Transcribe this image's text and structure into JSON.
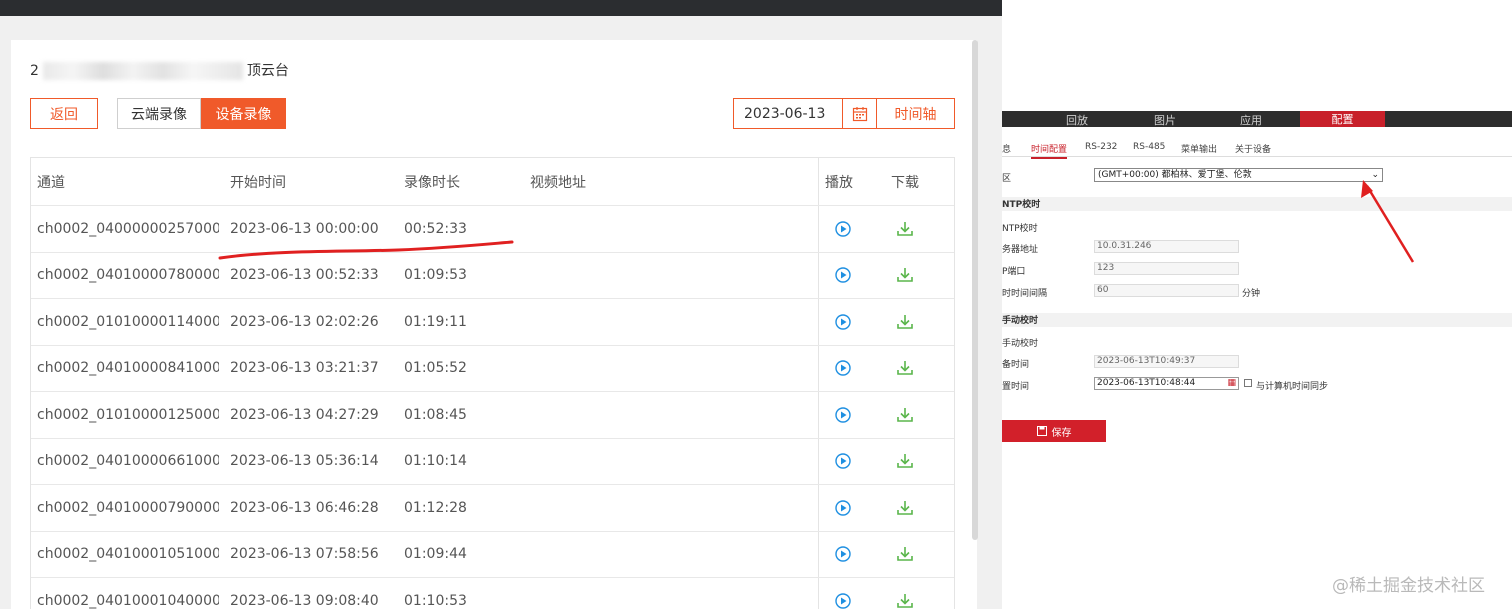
{
  "header": {
    "prefix": "2",
    "suffix": "顶云台"
  },
  "toolbar": {
    "back": "返回",
    "cloud": "云端录像",
    "device": "设备录像",
    "date": "2023-06-13",
    "timeline": "时间轴"
  },
  "table": {
    "columns": [
      "通道",
      "开始时间",
      "录像时长",
      "视频地址",
      "播放",
      "下载"
    ],
    "rows": [
      {
        "channel": "ch0002_04000000257000...",
        "start": "2023-06-13 00:00:00",
        "duration": "00:52:33"
      },
      {
        "channel": "ch0002_04010000780000...",
        "start": "2023-06-13 00:52:33",
        "duration": "01:09:53"
      },
      {
        "channel": "ch0002_01010000114000...",
        "start": "2023-06-13 02:02:26",
        "duration": "01:19:11"
      },
      {
        "channel": "ch0002_04010000841000...",
        "start": "2023-06-13 03:21:37",
        "duration": "01:05:52"
      },
      {
        "channel": "ch0002_01010000125000...",
        "start": "2023-06-13 04:27:29",
        "duration": "01:08:45"
      },
      {
        "channel": "ch0002_04010000661000...",
        "start": "2023-06-13 05:36:14",
        "duration": "01:10:14"
      },
      {
        "channel": "ch0002_04010000790000...",
        "start": "2023-06-13 06:46:28",
        "duration": "01:12:28"
      },
      {
        "channel": "ch0002_04010001051000...",
        "start": "2023-06-13 07:58:56",
        "duration": "01:09:44"
      },
      {
        "channel": "ch0002_04010001040000...",
        "start": "2023-06-13 09:08:40",
        "duration": "01:10:53"
      }
    ]
  },
  "colors": {
    "accent": "#f05a2a",
    "play": "#1e8fe1",
    "download": "#5ab54b",
    "device_red": "#c8202a"
  },
  "device_ui": {
    "top_tabs": [
      "回放",
      "图片",
      "应用",
      "配置"
    ],
    "sub_tabs": [
      "息",
      "时间配置",
      "RS-232",
      "RS-485",
      "菜单输出",
      "关于设备"
    ],
    "timezone_label": "区",
    "timezone": "(GMT+00:00) 都柏林、爱丁堡、伦敦",
    "ntp_section": "NTP校时",
    "ntp_check": "NTP校时",
    "server_label": "务器地址",
    "server": "10.0.31.246",
    "port_label": "P端口",
    "port": "123",
    "interval_label": "时时间间隔",
    "interval": "60",
    "interval_unit": "分钟",
    "manual_section": "手动校时",
    "manual_check": "手动校时",
    "device_time_label": "备时间",
    "device_time": "2023-06-13T10:49:37",
    "set_time_label": "置时间",
    "set_time": "2023-06-13T10:48:44",
    "sync_label": "与计算机时间同步",
    "save": "保存"
  },
  "watermark": "@稀土掘金技术社区"
}
